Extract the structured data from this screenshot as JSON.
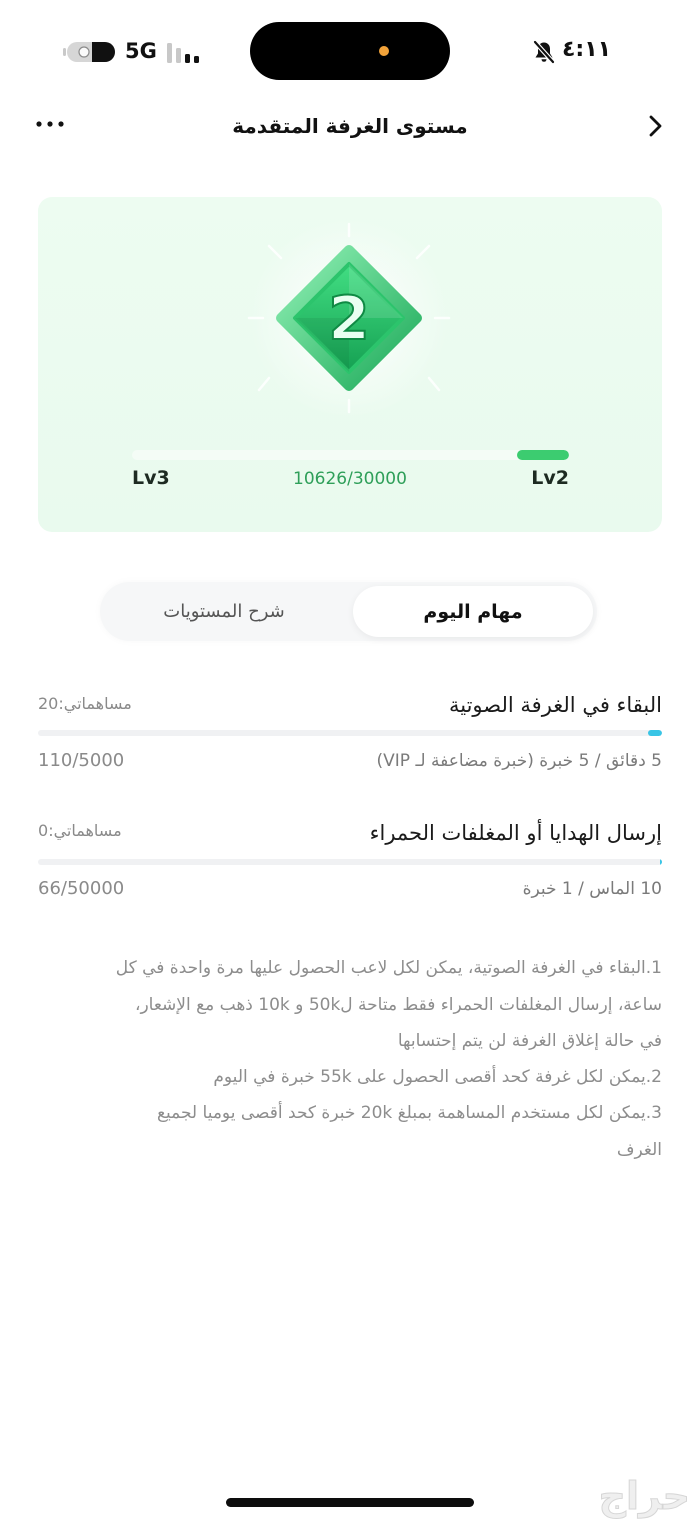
{
  "status_bar": {
    "time": "٤:١١",
    "network": "5G"
  },
  "header": {
    "title": "مستوى الغرفة المتقدمة"
  },
  "level_card": {
    "badge_level": "2",
    "next_level_label": "Lv3",
    "current_level_label": "Lv2",
    "progress_text": "10626/30000",
    "progress_fill": 0.12
  },
  "tabs": [
    {
      "label": "مهام اليوم",
      "active": true
    },
    {
      "label": "شرح المستويات",
      "active": false
    }
  ],
  "tasks": [
    {
      "title": "البقاء في الغرفة الصوتية",
      "contribution": "مساهماتي:20",
      "rule": "5 دقائق / 5 خبرة (خبرة مضاعفة لـ VIP)",
      "progress_text": "110/5000",
      "progress": 0.022
    },
    {
      "title": "إرسال الهدايا أو المغلفات الحمراء",
      "contribution": "مساهماتي:0",
      "rule": "10 الماس / 1 خبرة",
      "progress_text": "66/50000",
      "progress": 0.0013
    }
  ],
  "notes": {
    "lines": [
      "1.البقاء في الغرفة الصوتية، يمكن لكل لاعب الحصول عليها مرة واحدة في كل",
      "ساعة، إرسال المغلفات الحمراء فقط متاحة ل50k و 10k ذهب مع الإشعار،",
      "في حالة إغلاق الغرفة لن يتم إحتسابها",
      "2.يمكن لكل غرفة كحد أقصى الحصول على 55k خبرة في اليوم",
      "3.يمكن لكل مستخدم المساهمة بمبلغ 20k خبرة كحد أقصى يوميا لجميع",
      "الغرف"
    ]
  },
  "watermark": "حراج",
  "colors": {
    "level_progress": "#3ccc70",
    "level_text": "#2f9f59",
    "task_progress": "#39c5e6",
    "card_background": "#e9faee"
  },
  "icons": {
    "back": "chevron-right-icon",
    "more": "more-dots-icon",
    "mute": "bell-slash-icon",
    "battery": "battery-icon",
    "signal": "cellular-signal-icon",
    "badge": "green-diamond-badge"
  }
}
